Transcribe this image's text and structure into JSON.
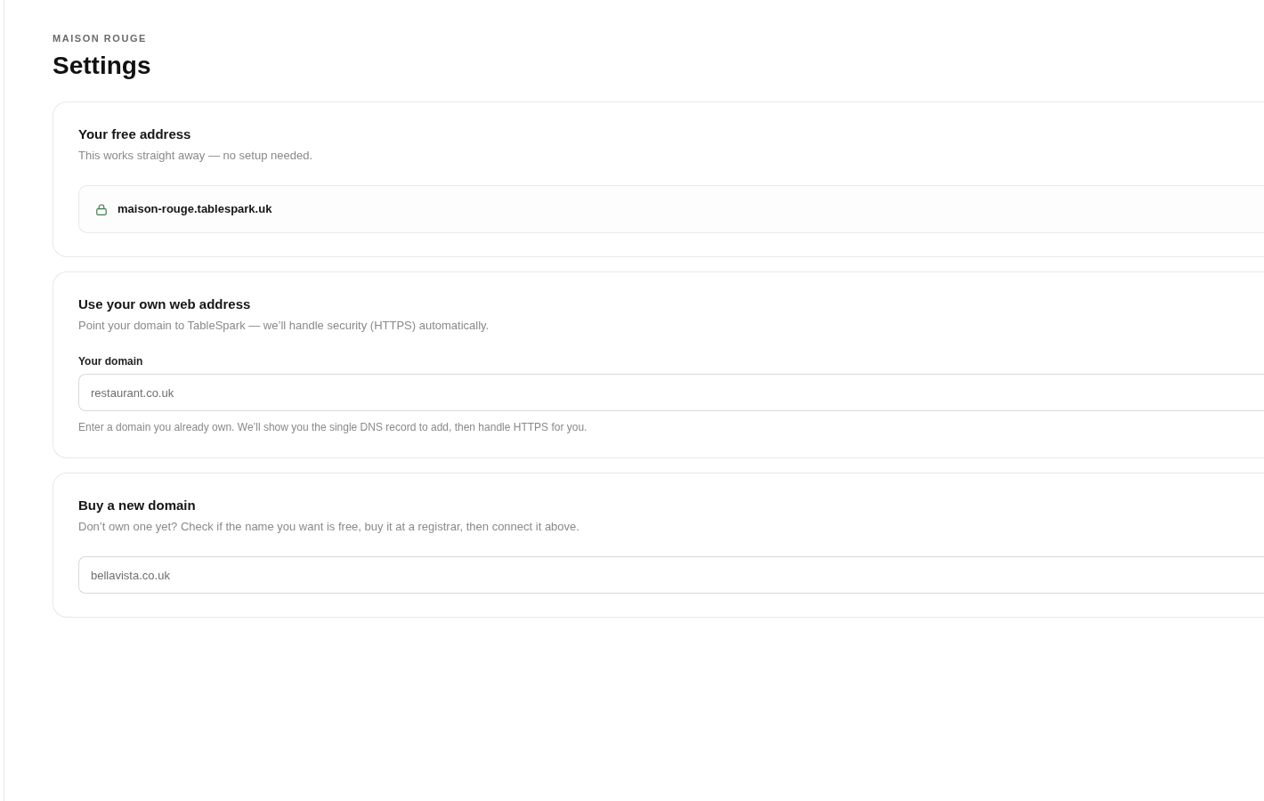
{
  "header": {
    "brand": "MAISON ROUGE",
    "title": "Settings"
  },
  "sections": [
    {
      "kind": "address",
      "title": "Your free address",
      "description": "This works straight away — no setup needed.",
      "address": "maison-rouge.tablespark.uk"
    },
    {
      "kind": "input",
      "title": "Use your own web address",
      "description": "Point your domain to TableSpark — we’ll handle security (HTTPS) automatically.",
      "field": {
        "label": "Your domain",
        "placeholder": "restaurant.co.uk",
        "hint": "Enter a domain you already own. We’ll show you the single DNS record to add, then handle HTTPS for you."
      }
    },
    {
      "kind": "input",
      "title": "Buy a new domain",
      "description": "Don’t own one yet? Check if the name you want is free, buy it at a registrar, then connect it above.",
      "field": {
        "placeholder": "bellavista.co.uk"
      }
    }
  ]
}
